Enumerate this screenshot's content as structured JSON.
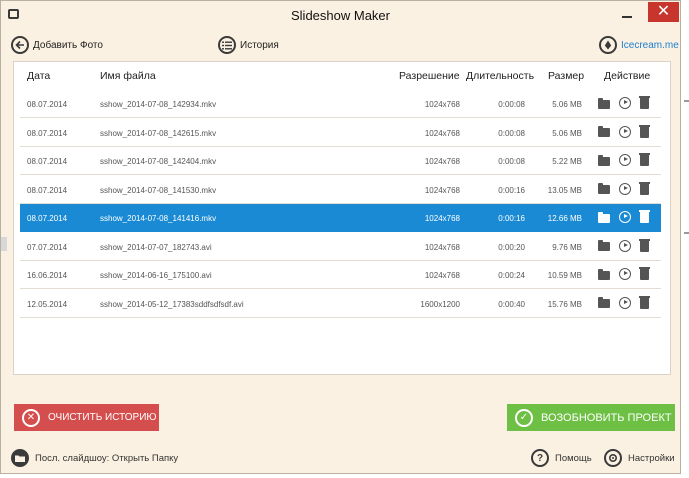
{
  "window": {
    "title": "Slideshow Maker",
    "close_glyph": "✕"
  },
  "toolbar": {
    "add_photo_label": "Добавить Фото",
    "history_label": "История",
    "brand_link": "Icecream.me"
  },
  "table": {
    "headers": {
      "date": "Дата",
      "filename": "Имя файла",
      "resolution": "Разрешение",
      "duration": "Длительность",
      "size": "Размер",
      "action": "Действие"
    },
    "rows": [
      {
        "date": "08.07.2014",
        "file": "sshow_2014-07-08_142934.mkv",
        "res": "1024x768",
        "dur": "0:00:08",
        "size": "5.06 MB"
      },
      {
        "date": "08.07.2014",
        "file": "sshow_2014-07-08_142615.mkv",
        "res": "1024x768",
        "dur": "0:00:08",
        "size": "5.06 MB"
      },
      {
        "date": "08.07.2014",
        "file": "sshow_2014-07-08_142404.mkv",
        "res": "1024x768",
        "dur": "0:00:08",
        "size": "5.22 MB"
      },
      {
        "date": "08.07.2014",
        "file": "sshow_2014-07-08_141530.mkv",
        "res": "1024x768",
        "dur": "0:00:16",
        "size": "13.05 MB"
      },
      {
        "date": "08.07.2014",
        "file": "sshow_2014-07-08_141416.mkv",
        "res": "1024x768",
        "dur": "0:00:16",
        "size": "12.66 MB"
      },
      {
        "date": "07.07.2014",
        "file": "sshow_2014-07-07_182743.avi",
        "res": "1024x768",
        "dur": "0:00:20",
        "size": "9.76 MB"
      },
      {
        "date": "16.06.2014",
        "file": "sshow_2014-06-16_175100.avi",
        "res": "1024x768",
        "dur": "0:00:24",
        "size": "10.59 MB"
      },
      {
        "date": "12.05.2014",
        "file": "sshow_2014-05-12_17383sddfsdfsdf.avi",
        "res": "1600x1200",
        "dur": "0:00:40",
        "size": "15.76 MB"
      }
    ]
  },
  "buttons": {
    "clear_history_label": "ОЧИСТИТЬ ИСТОРИЮ",
    "clear_glyph": "✕",
    "resume_project_label": "ВОЗОБНОВИТЬ ПРОЕКТ",
    "resume_glyph": "✓"
  },
  "footer": {
    "last_slideshow_label": "Посл. слайдшоу: Открыть Папку",
    "help_label": "Помощь",
    "help_glyph": "?",
    "settings_label": "Настройки"
  },
  "colors": {
    "background": "#fbf1e2",
    "selection": "#1a8ad4",
    "clear_button": "#d44e4e",
    "resume_button": "#6dc043",
    "close_button": "#c7352d",
    "link": "#1a7fd0"
  },
  "icons": [
    "app-icon",
    "back-arrow-icon",
    "list-icon",
    "ice-drop-icon",
    "folder-icon",
    "play-icon",
    "trash-icon",
    "close-icon",
    "check-icon",
    "question-icon",
    "gear-icon"
  ]
}
